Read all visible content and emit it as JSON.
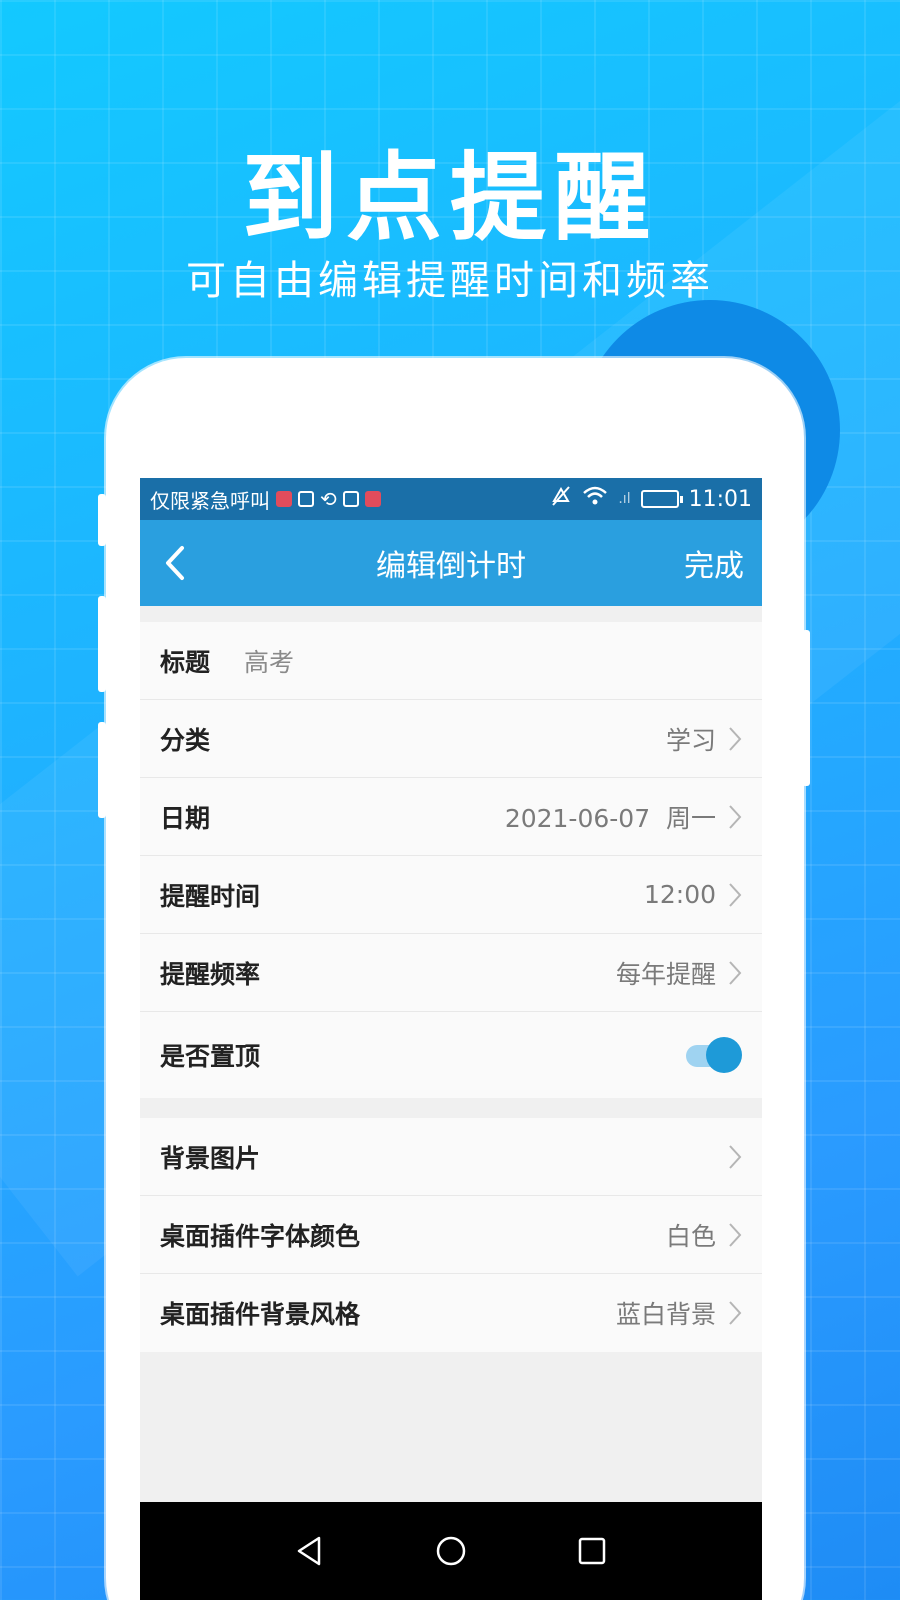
{
  "promo": {
    "headline": "到点提醒",
    "subline": "可自由编辑提醒时间和频率"
  },
  "status_bar": {
    "carrier_text": "仅限紧急呼叫",
    "time": "11:01",
    "signal_text": ".ıl"
  },
  "app_bar": {
    "title": "编辑倒计时",
    "done_label": "完成",
    "back_icon": "chevron-left-icon"
  },
  "form_main": {
    "title_label": "标题",
    "title_value": "高考",
    "category_label": "分类",
    "category_value": "学习",
    "date_label": "日期",
    "date_value": "2021-06-07  周一",
    "remind_time_label": "提醒时间",
    "remind_time_value": "12:00",
    "remind_freq_label": "提醒频率",
    "remind_freq_value": "每年提醒",
    "pin_label": "是否置顶",
    "pin_on": true
  },
  "form_widget": {
    "bg_image_label": "背景图片",
    "font_color_label": "桌面插件字体颜色",
    "font_color_value": "白色",
    "bg_style_label": "桌面插件背景风格",
    "bg_style_value": "蓝白背景"
  },
  "colors": {
    "app_bar": "#2a9fdf",
    "status_bar": "#1a6fa8",
    "toggle_on": "#1e9ad8"
  }
}
